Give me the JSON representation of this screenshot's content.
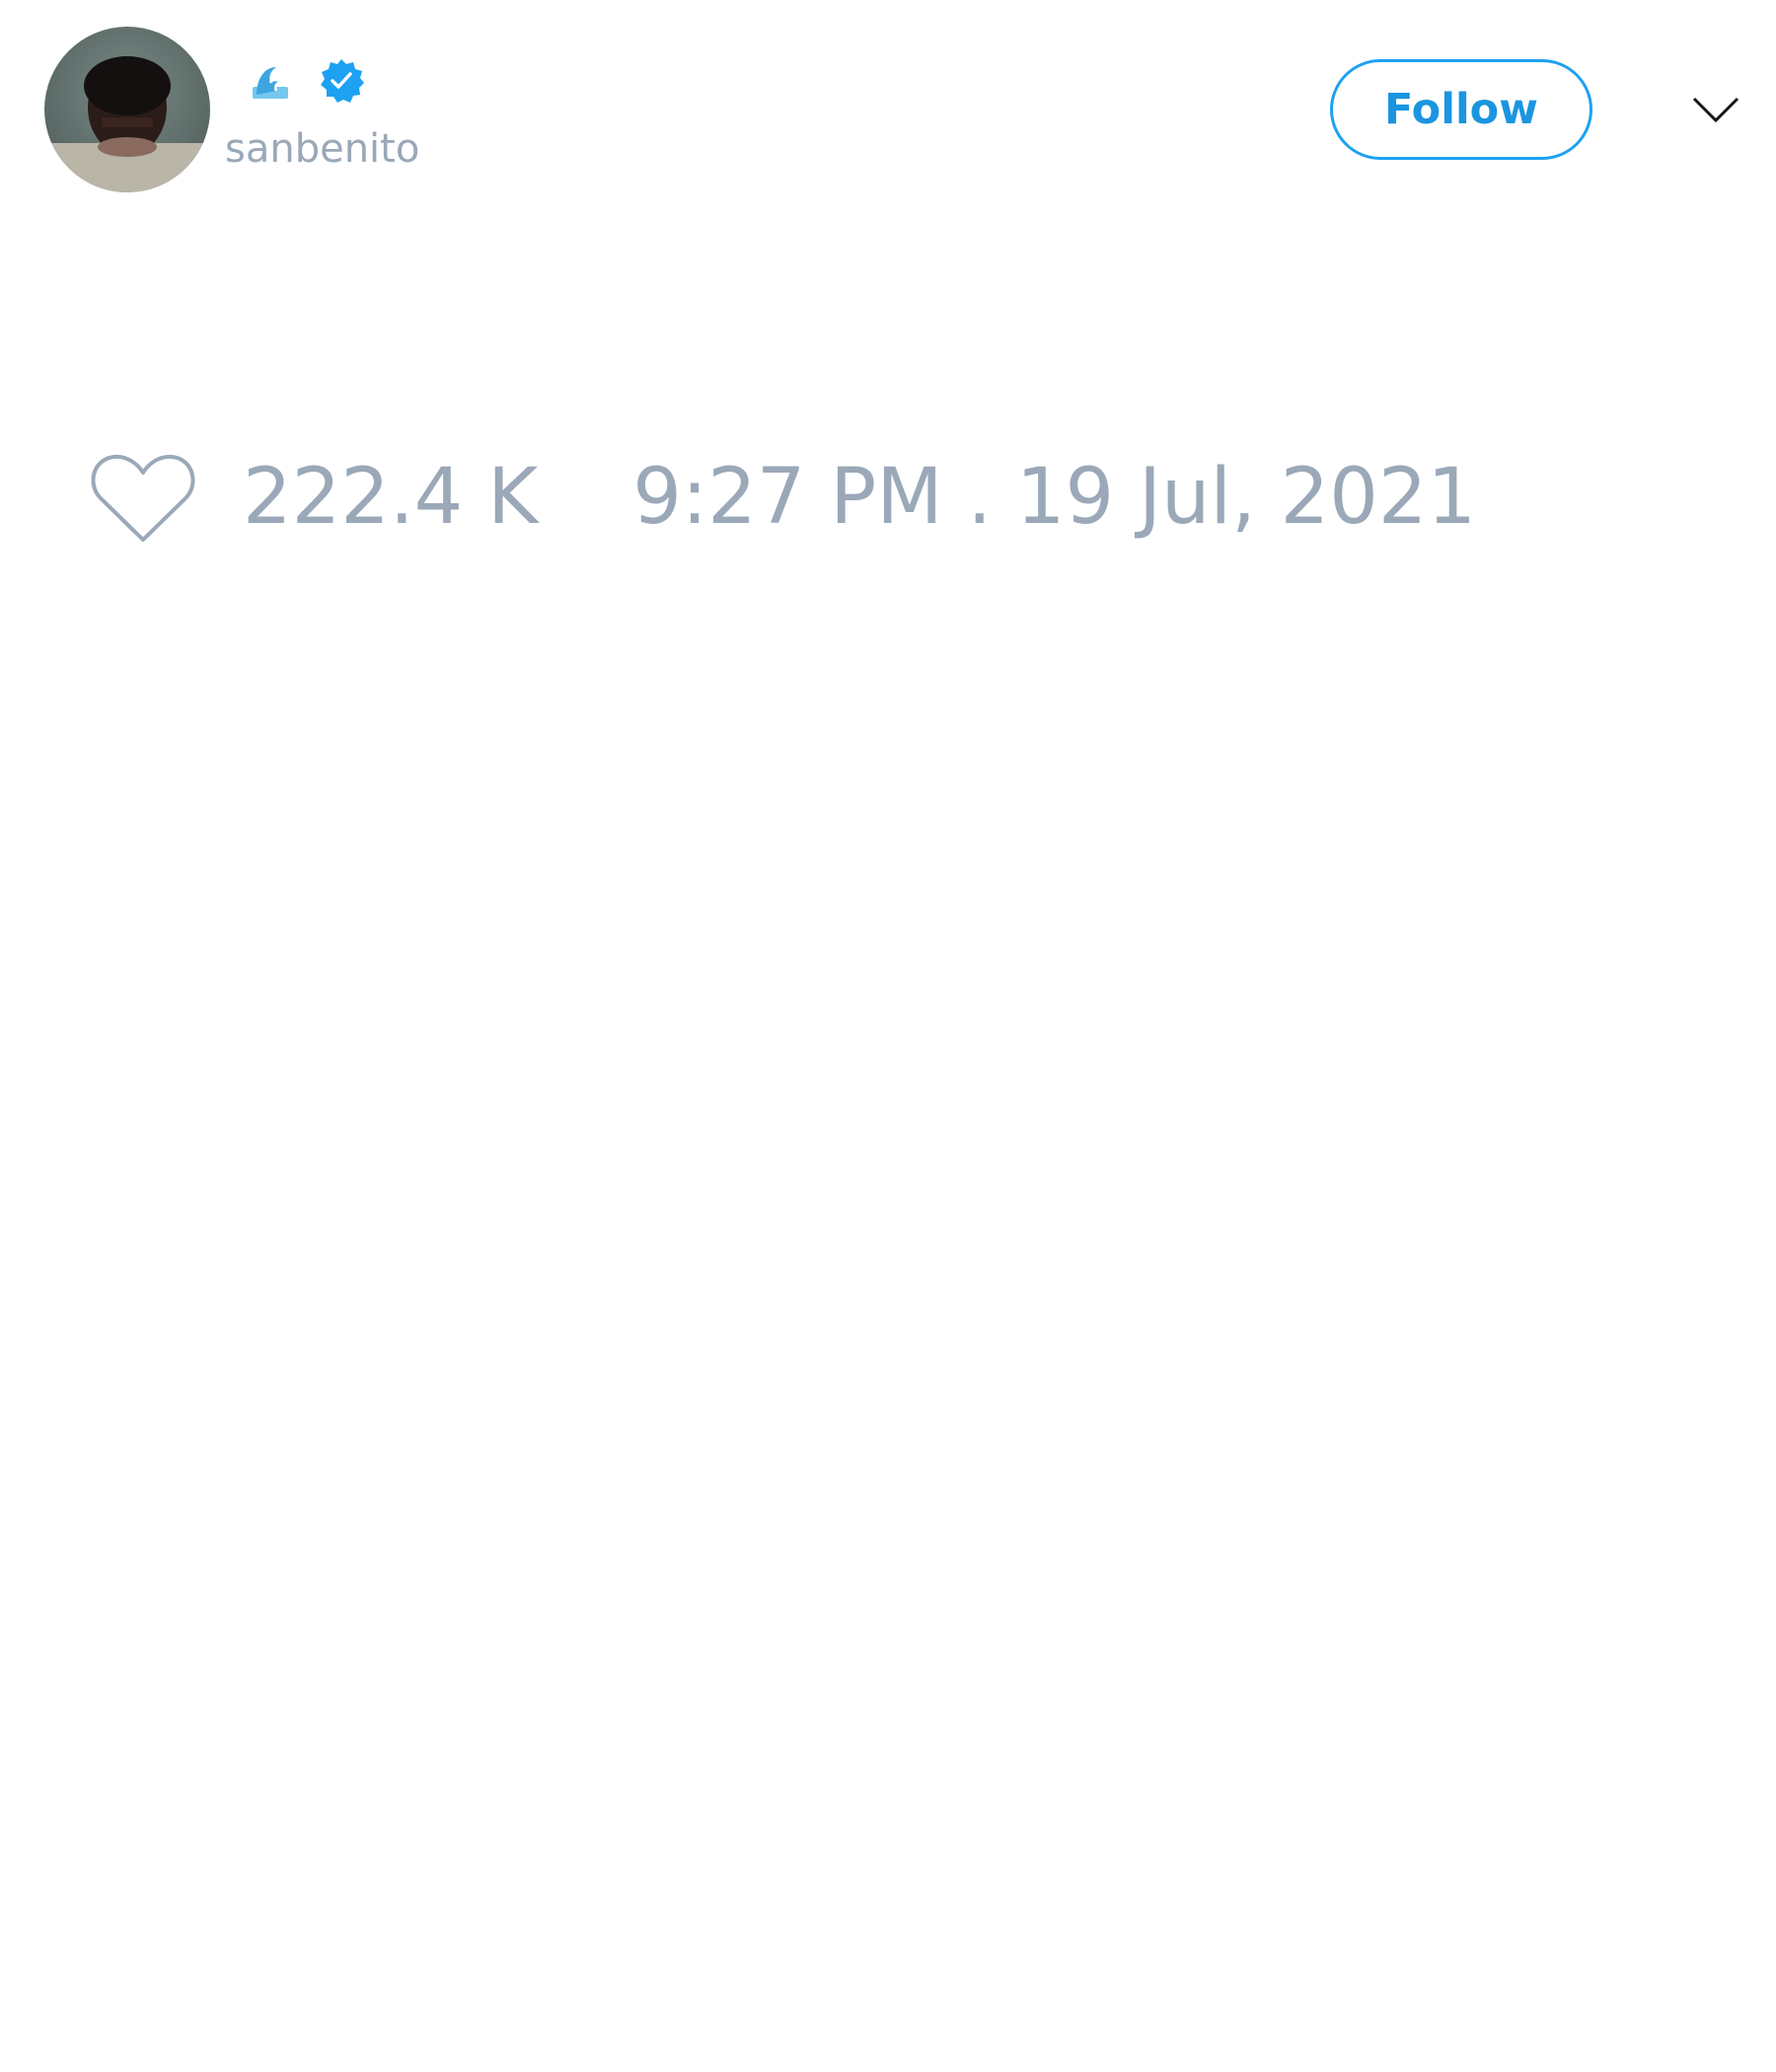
{
  "tweet": {
    "author": {
      "handle": "sanbenito",
      "display_name_icon": "water-wave-icon",
      "verified_icon": "verified-badge-icon",
      "avatar": "avatar-photo"
    },
    "follow_button_label": "Follow",
    "menu_icon": "chevron-down-icon",
    "like_icon": "heart-icon",
    "like_count": "222.4 K",
    "timestamp": "9:27 PM . 19 Jul, 2021"
  },
  "colors": {
    "accent": "#1da1f2",
    "follow_text": "#1b95e0",
    "muted_text": "#9aa8b8",
    "background": "#ffffff"
  }
}
